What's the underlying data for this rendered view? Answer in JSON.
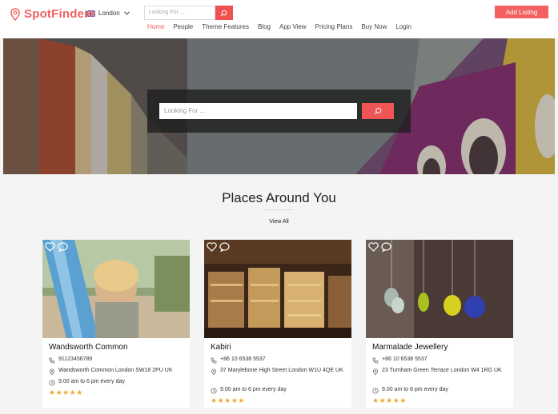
{
  "header": {
    "logo_text": "SpotFinder",
    "city": "London",
    "search_placeholder": "Looking For ...",
    "add_listing": "Add Listing"
  },
  "nav": [
    "Home",
    "People",
    "Theme Features",
    "Blog",
    "App View",
    "Pricing Plans",
    "Buy Now",
    "Login"
  ],
  "hero": {
    "search_placeholder": "Looking For ..."
  },
  "section": {
    "title": "Places Around You",
    "view_all": "View All"
  },
  "cards": [
    {
      "title": "Wandsworth Common",
      "phone": "91123456789",
      "address": "Wandsworth Common London SW18 2PU UK",
      "hours": "9.00 am to 6 pm every day",
      "rating": "★★★★★"
    },
    {
      "title": "Kabiri",
      "phone": "+86 10 6538 5537",
      "address": "37 Marylebone High Street London W1U 4QE UK",
      "hours": "9.00 am to 6 pm every day",
      "rating": "★★★★★"
    },
    {
      "title": "Marmalade Jewellery",
      "phone": "+86 10 6538 5537",
      "address": "23 Turnham Green Terrace London W4 1RG UK",
      "hours": "9.00 am to 6 pm every day",
      "rating": "★★★★★"
    }
  ],
  "colors": {
    "accent": "#f06060"
  }
}
